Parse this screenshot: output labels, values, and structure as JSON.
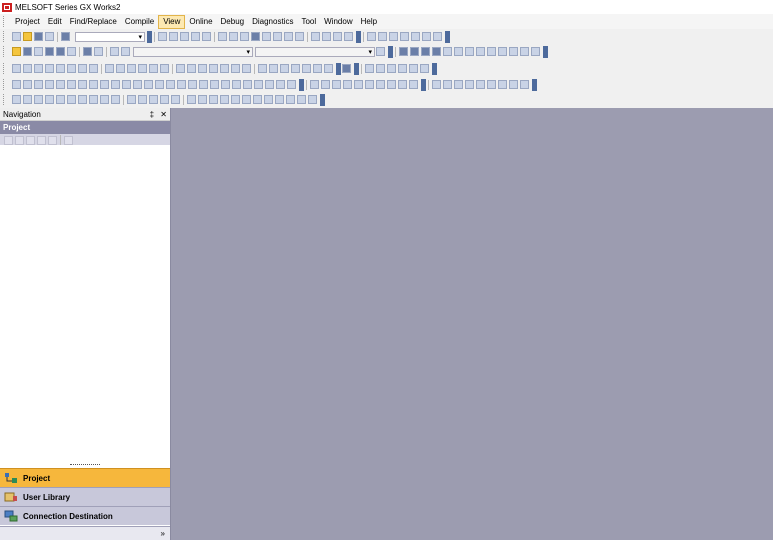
{
  "window": {
    "title": "MELSOFT Series GX Works2"
  },
  "menu": {
    "items": [
      "Project",
      "Edit",
      "Find/Replace",
      "Compile",
      "View",
      "Online",
      "Debug",
      "Diagnostics",
      "Tool",
      "Window",
      "Help"
    ],
    "active": "View"
  },
  "navigation": {
    "title": "Navigation",
    "pin": "‡",
    "close": "✕",
    "section": "Project",
    "buttons": {
      "project": "Project",
      "user_library": "User Library",
      "connection_destination": "Connection Destination"
    },
    "more": "»"
  },
  "icons": {
    "app": "melsoft-logo-icon",
    "project": "project-tree-icon",
    "user_library": "library-icon",
    "connection_destination": "connection-icon"
  },
  "colors": {
    "workspace": "#9c9cb0",
    "accent": "#f6b73c",
    "nav_header": "#8a8aa6"
  }
}
